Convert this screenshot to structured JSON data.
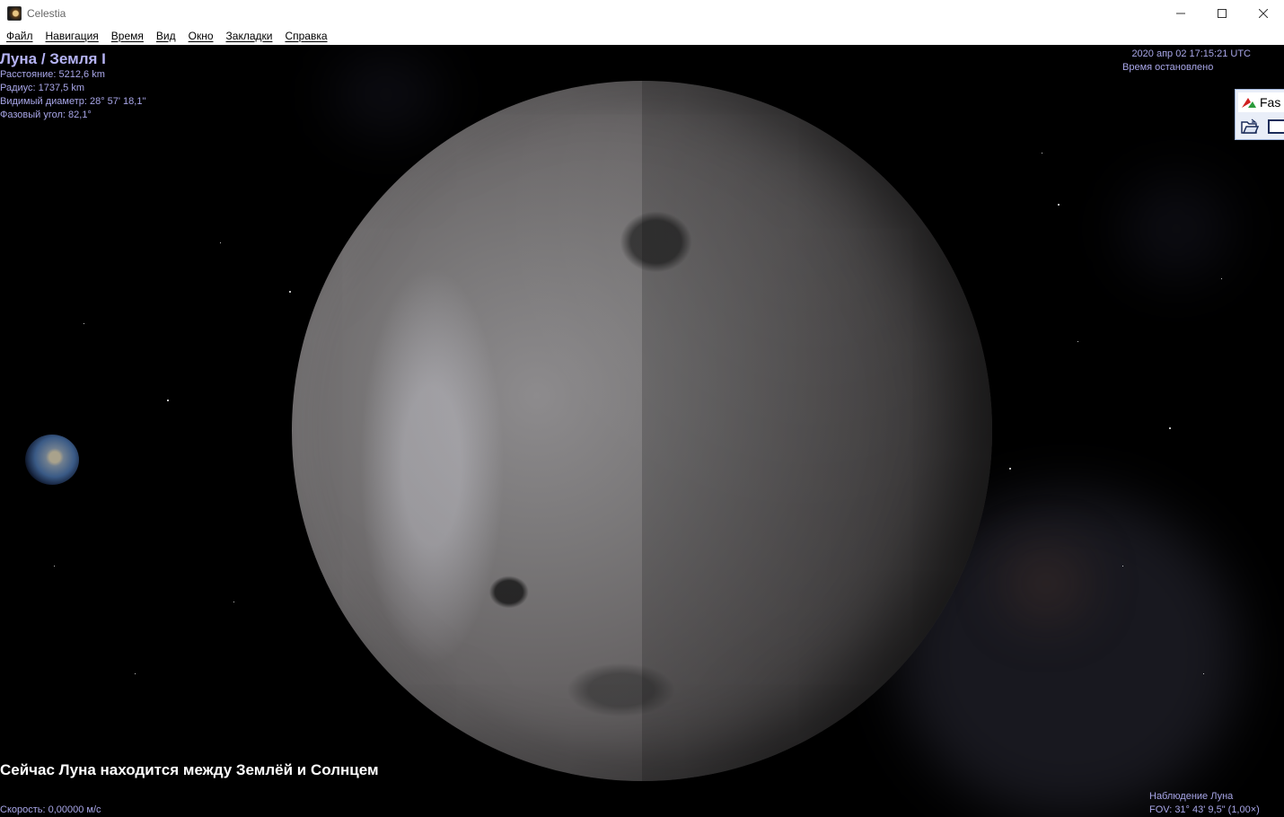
{
  "window": {
    "title": "Celestia",
    "controls": [
      "minimize",
      "maximize",
      "close"
    ]
  },
  "menu": {
    "items": [
      "Файл",
      "Навигация",
      "Время",
      "Вид",
      "Окно",
      "Закладки",
      "Справка"
    ]
  },
  "hud": {
    "object_name": "Луна / Земля I",
    "distance": "Расстояние: 5212,6 km",
    "radius": "Радиус: 1737,5 km",
    "apparent_diameter": "Видимый диаметр: 28° 57' 18,1\"",
    "phase_angle": "Фазовый угол: 82,1°",
    "datetime": "2020 апр 02 17:15:21 UTC",
    "time_status": "Время остановлено",
    "message": "Сейчас Луна находится между Землёй и Солнцем",
    "speed": "Скорость: 0,00000 м/с",
    "tracking": "Наблюдение Луна",
    "fov": "FOV: 31° 43' 9,5\" (1,00×)"
  },
  "tool_window": {
    "label": "Fas"
  },
  "colors": {
    "hud_text": "#a8a6e8",
    "hud_title": "#b5b3f4",
    "message_text": "#ffffff",
    "space_background": "#000000"
  }
}
